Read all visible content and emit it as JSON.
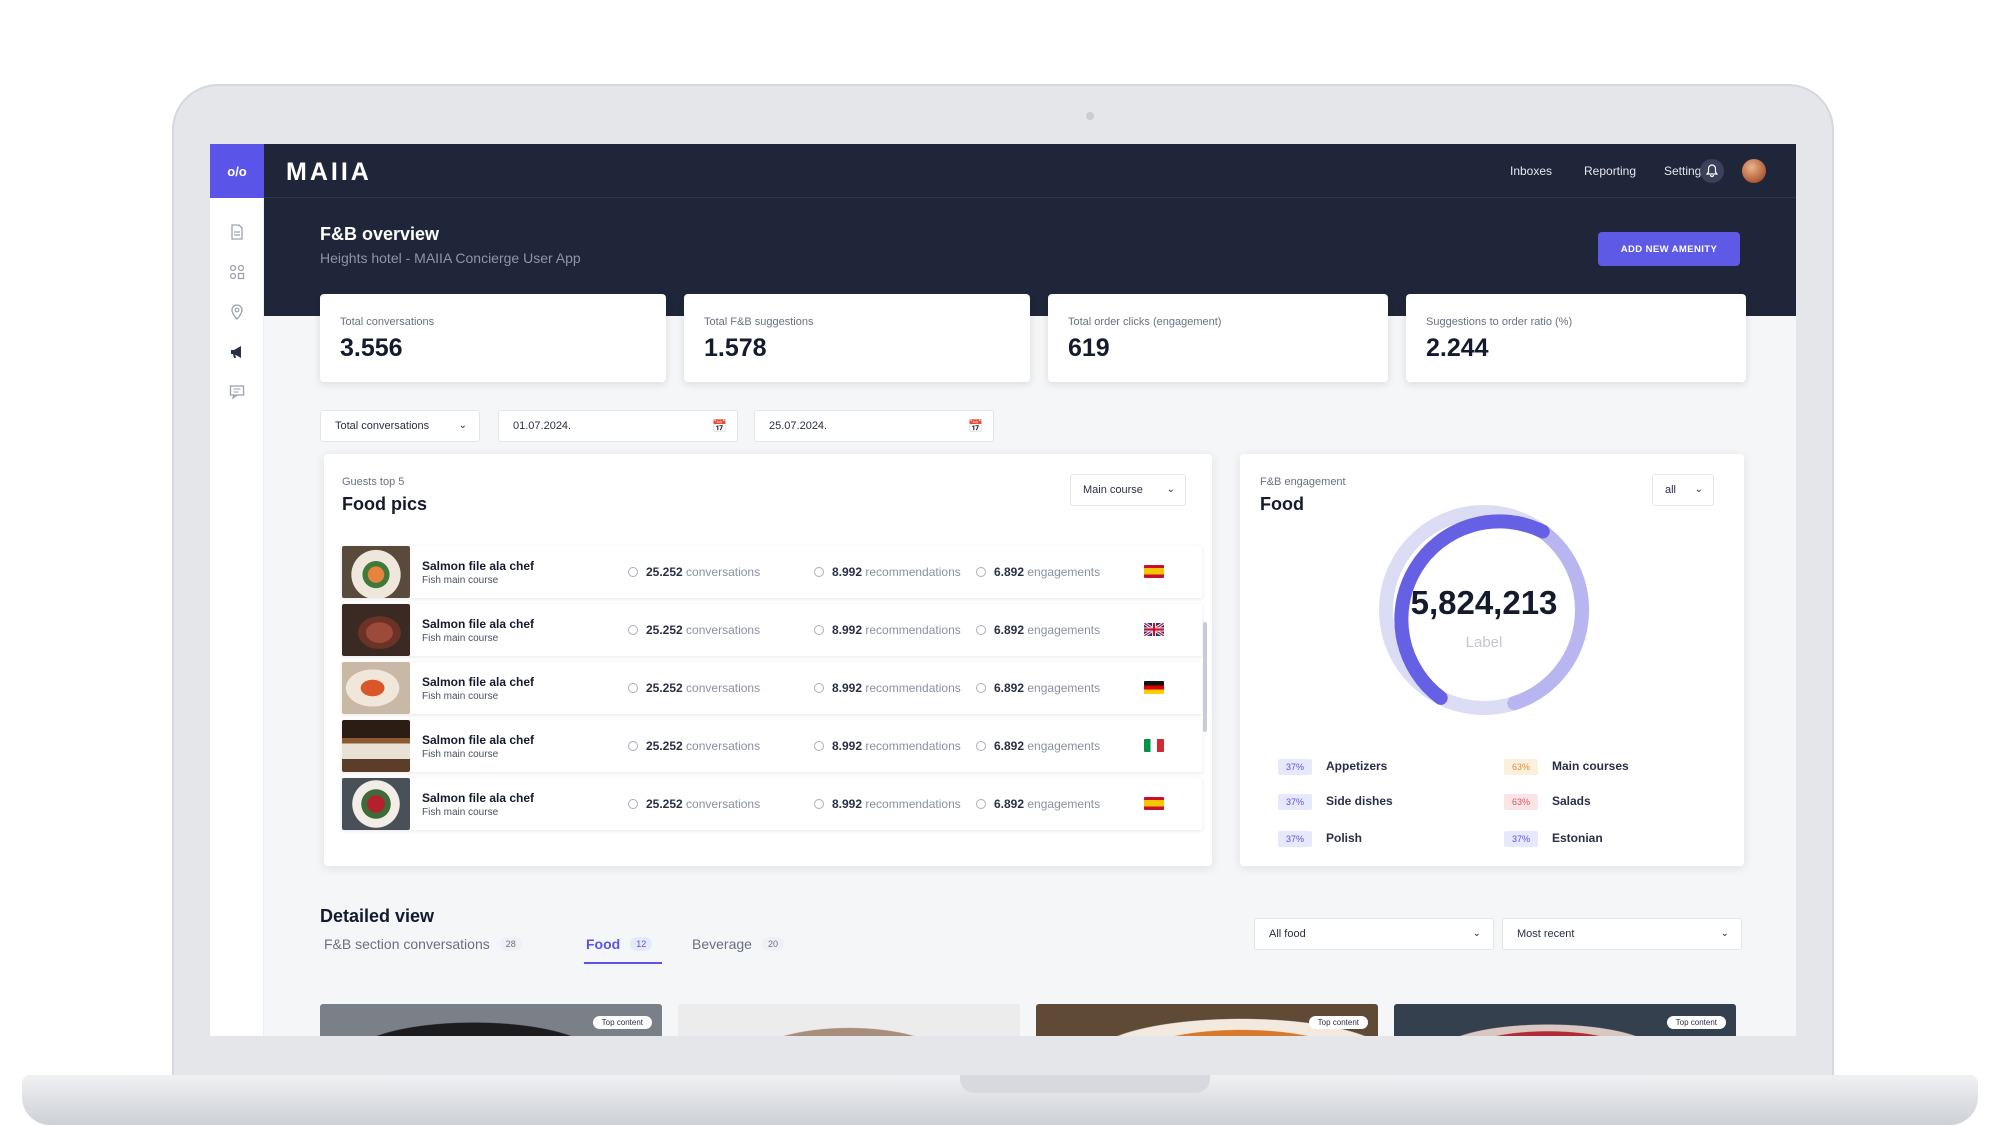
{
  "sidebar": {
    "logo": "o/o",
    "icons": [
      "document-icon",
      "grid-icon",
      "location-icon",
      "megaphone-icon",
      "feedback-icon"
    ]
  },
  "topbar": {
    "brand": "MAIIA",
    "nav": [
      "Inboxes",
      "Reporting",
      "Settings"
    ]
  },
  "hero": {
    "title": "F&B overview",
    "subtitle": "Heights hotel - MAIIA Concierge User App",
    "add_button": "ADD NEW AMENITY"
  },
  "stats": [
    {
      "label": "Total conversations",
      "value": "3.556"
    },
    {
      "label": "Total F&B suggestions",
      "value": "1.578"
    },
    {
      "label": "Total order clicks (engagement)",
      "value": "619"
    },
    {
      "label": "Suggestions to order ratio (%)",
      "value": "2.244"
    }
  ],
  "filters": {
    "metric": "Total conversations",
    "date_from": "01.07.2024.",
    "date_to": "25.07.2024."
  },
  "food_pics": {
    "kicker": "Guests top 5",
    "title": "Food pics",
    "dropdown": "Main course",
    "rows": [
      {
        "name": "Salmon file ala chef",
        "sub": "Fish main course",
        "conversations": "25.252",
        "conv_label": "conversations",
        "recommendations": "8.992",
        "rec_label": "recommendations",
        "engagements": "6.892",
        "eng_label": "engagements",
        "flag": "spain-flag"
      },
      {
        "name": "Salmon file ala chef",
        "sub": "Fish main course",
        "conversations": "25.252",
        "conv_label": "conversations",
        "recommendations": "8.992",
        "rec_label": "recommendations",
        "engagements": "6.892",
        "eng_label": "engagements",
        "flag": "uk-flag"
      },
      {
        "name": "Salmon file ala chef",
        "sub": "Fish main course",
        "conversations": "25.252",
        "conv_label": "conversations",
        "recommendations": "8.992",
        "rec_label": "recommendations",
        "engagements": "6.892",
        "eng_label": "engagements",
        "flag": "germany-flag"
      },
      {
        "name": "Salmon file ala chef",
        "sub": "Fish main course",
        "conversations": "25.252",
        "conv_label": "conversations",
        "recommendations": "8.992",
        "rec_label": "recommendations",
        "engagements": "6.892",
        "eng_label": "engagements",
        "flag": "italy-flag"
      },
      {
        "name": "Salmon file ala chef",
        "sub": "Fish main course",
        "conversations": "25.252",
        "conv_label": "conversations",
        "recommendations": "8.992",
        "rec_label": "recommendations",
        "engagements": "6.892",
        "eng_label": "engagements",
        "flag": "spain-flag"
      }
    ]
  },
  "engagement": {
    "kicker": "F&B engagement",
    "title": "Food",
    "dropdown": "all",
    "center_value": "5,824,213",
    "center_label": "Label",
    "legend": [
      {
        "pct": "37%",
        "label": "Appetizers",
        "tone": "blue"
      },
      {
        "pct": "63%",
        "label": "Main courses",
        "tone": "orange"
      },
      {
        "pct": "37%",
        "label": "Side dishes",
        "tone": "blue"
      },
      {
        "pct": "63%",
        "label": "Salads",
        "tone": "red"
      },
      {
        "pct": "37%",
        "label": "Polish",
        "tone": "blue"
      },
      {
        "pct": "37%",
        "label": "Estonian",
        "tone": "blue"
      }
    ]
  },
  "detailed": {
    "title": "Detailed view",
    "tabs": [
      {
        "label": "F&B section conversations",
        "count": "28"
      },
      {
        "label": "Food",
        "count": "12"
      },
      {
        "label": "Beverage",
        "count": "20"
      }
    ],
    "filter_food": "All food",
    "sort": "Most recent",
    "badge": "Top content"
  },
  "colors": {
    "accent": "#5a55e8",
    "dark": "#20263a"
  }
}
